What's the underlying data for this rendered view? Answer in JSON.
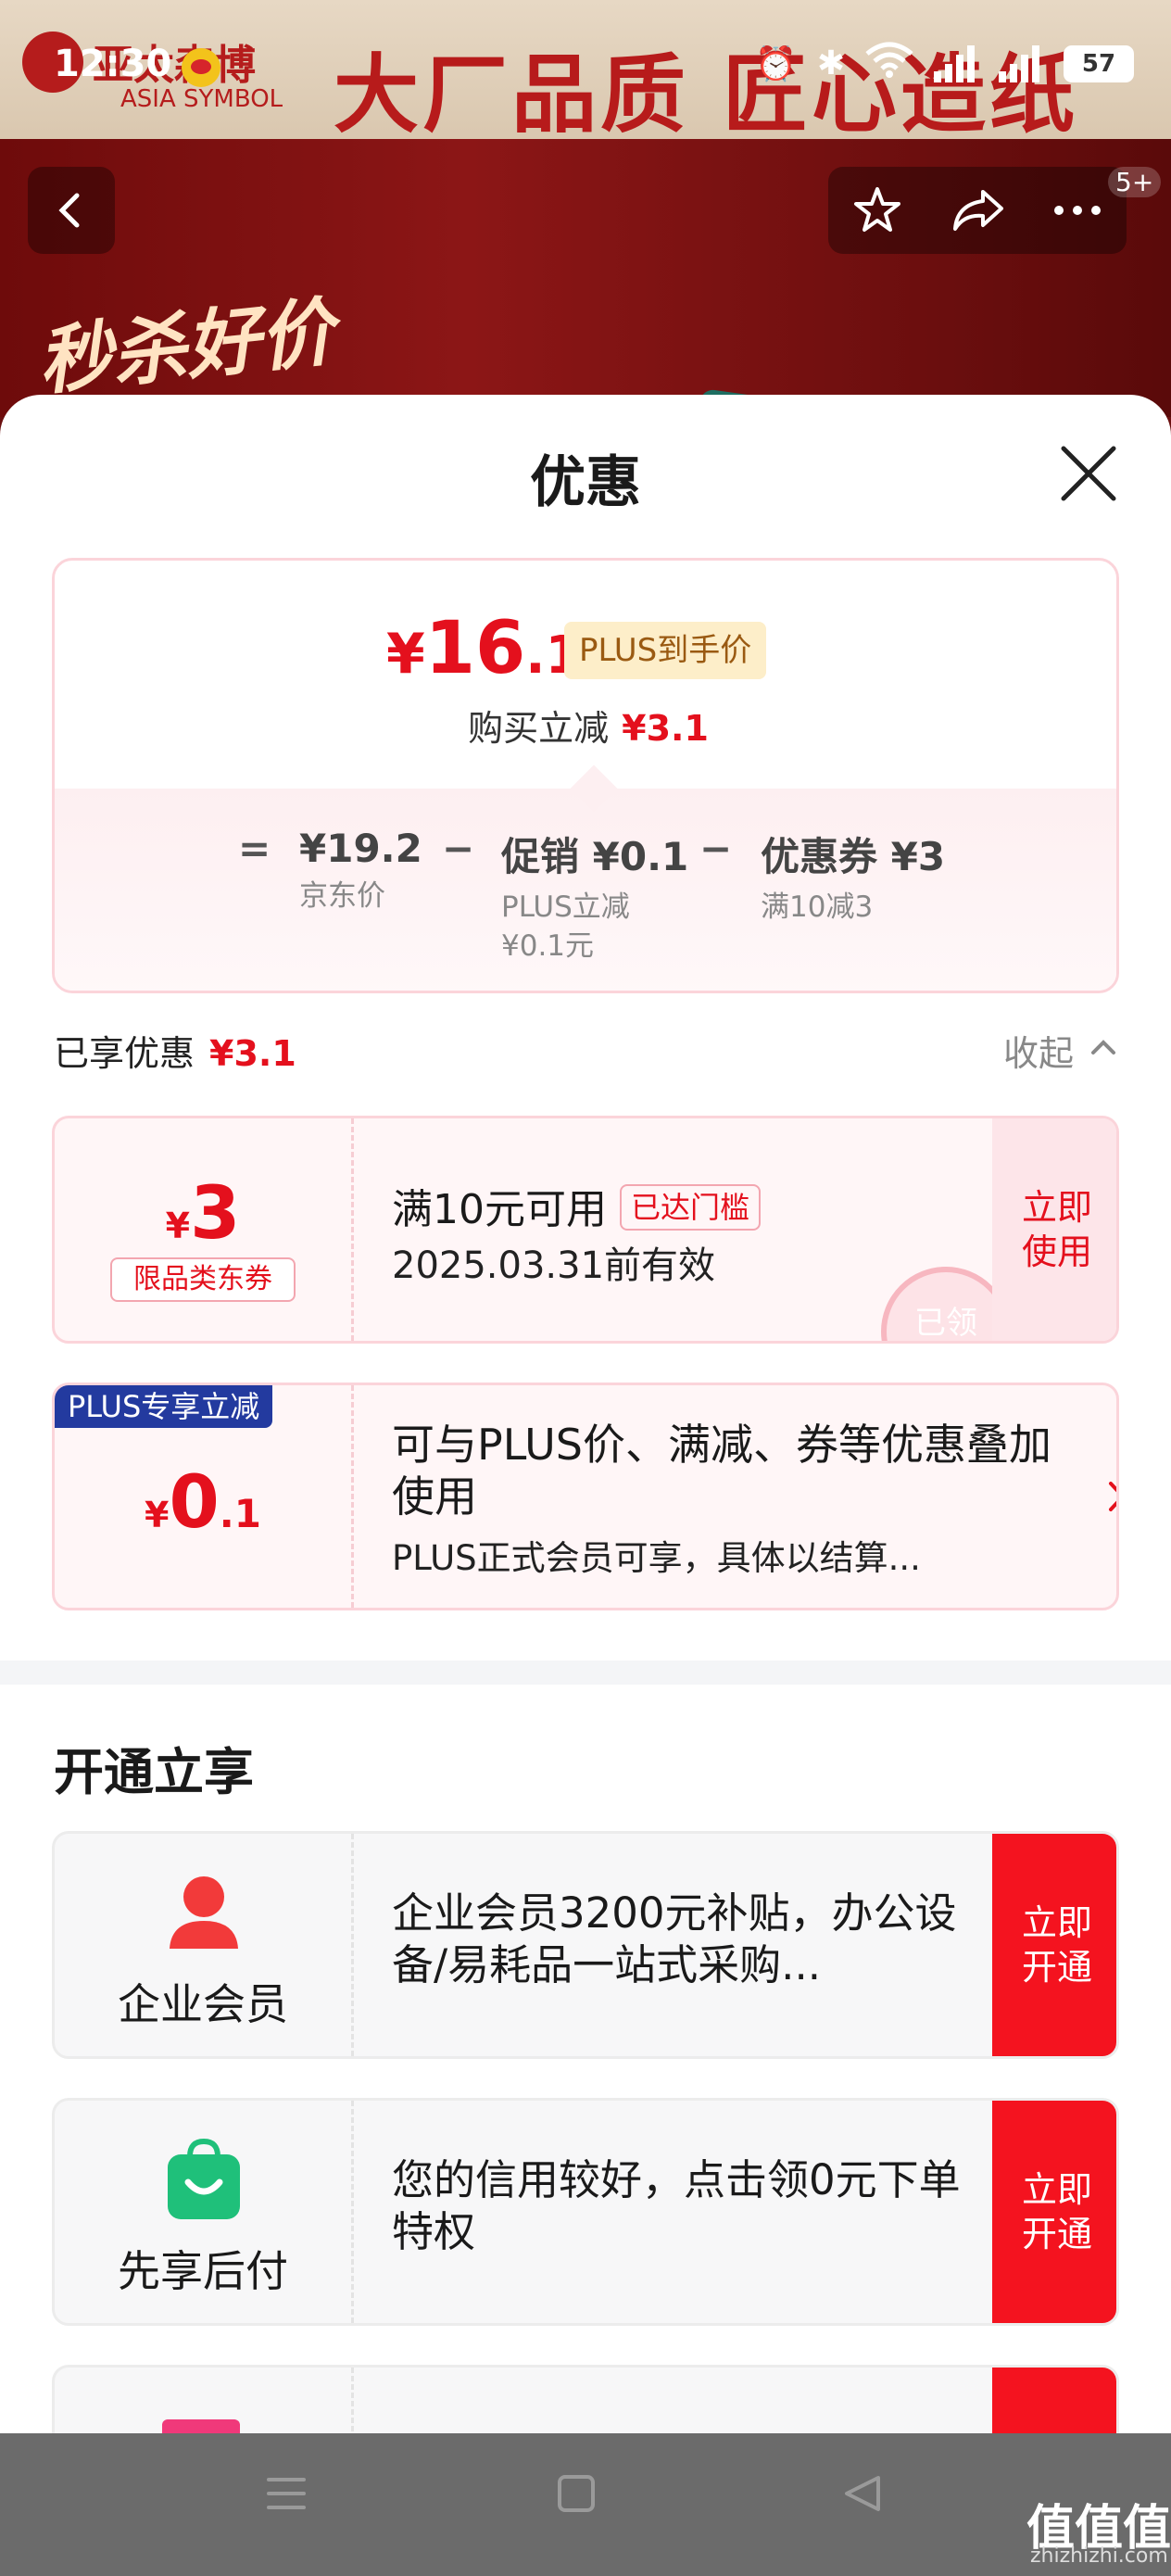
{
  "status_bar": {
    "time": "12:30",
    "battery": "57"
  },
  "background": {
    "brand_cn": "亚太森博",
    "brand_en": "ASIA SYMBOL",
    "slogan": "大厂品质 匠心造纸",
    "promo": "秒杀好价",
    "badge": "5+"
  },
  "sheet": {
    "title": "优惠",
    "summary": {
      "currency": "¥",
      "final_int": "16",
      "final_dec": ".1",
      "plus_tag": "PLUS到手价",
      "reduce_label": "购买立减",
      "reduce_value": "¥3.1",
      "breakdown": [
        {
          "op": "=",
          "main": "¥19.2",
          "sub": "京东价"
        },
        {
          "op": "−",
          "main": "促销 ¥0.1",
          "sub": "PLUS立减\n¥0.1元"
        },
        {
          "op": "−",
          "main": "优惠券 ¥3",
          "sub": "满10减3"
        }
      ]
    },
    "enjoyed": {
      "label": "已享优惠",
      "value": "¥3.1",
      "collapse": "收起"
    },
    "coupon1": {
      "currency": "¥",
      "amount": "3",
      "type": "限品类东券",
      "title": "满10元可用",
      "tag": "已达门槛",
      "validity": "2025.03.31前有效",
      "stamp": "已领",
      "action": "立即\n使用"
    },
    "coupon2": {
      "ribbon": "PLUS专享立减",
      "currency": "¥",
      "amount_int": "0",
      "amount_dec": ".1",
      "desc": "可与PLUS价、满减、券等优惠叠加使用",
      "desc2": "PLUS正式会员可享，具体以结算..."
    },
    "section_title": "开通立享",
    "memberships": [
      {
        "name": "企业会员",
        "icon": "person-icon",
        "desc": "企业会员3200元补贴，办公设备/易耗品一站式采购...",
        "action": "立即\n开通"
      },
      {
        "name": "先享后付",
        "icon": "shopping-bag-icon",
        "desc": "您的信用较好，点击领0元下单特权",
        "action": "立即\n开通"
      }
    ]
  },
  "watermark": {
    "main": "值值值",
    "sub": "zhizhizhi.com"
  },
  "colors": {
    "accent": "#e4101d",
    "plus_blue": "#233a9f",
    "action_red": "#f4131f"
  }
}
